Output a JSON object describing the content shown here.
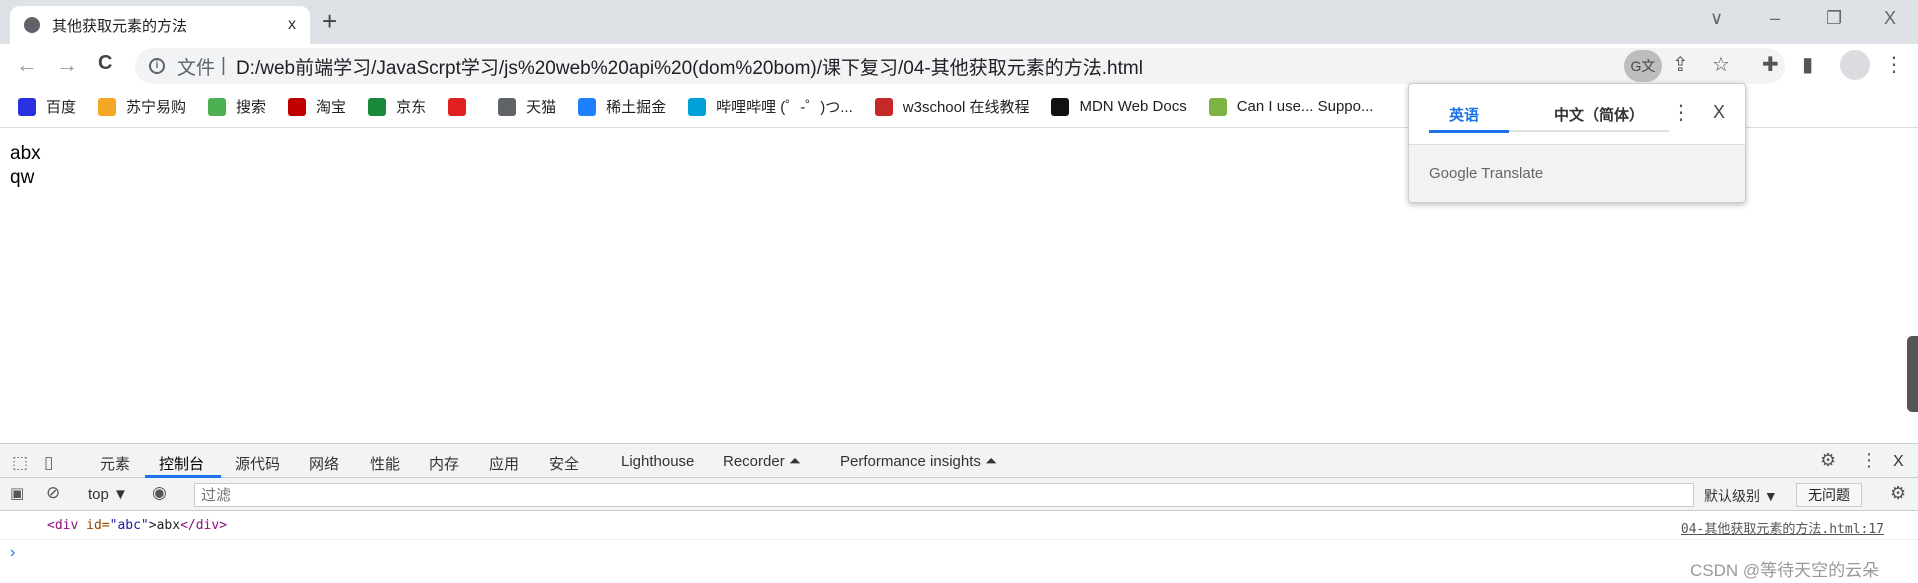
{
  "browser": {
    "tab_title": "其他获取元素的方法",
    "tab_close": "x",
    "new_tab": "+",
    "window_controls": {
      "tab_search": "∨",
      "minimize": "–",
      "restore": "❐",
      "close": "X"
    }
  },
  "toolbar": {
    "back": "←",
    "forward": "→",
    "reload": "C",
    "scheme_label": "文件",
    "separator": "|",
    "url": "D:/web前端学习/JavaScrpt学习/js%20web%20api%20(dom%20bom)/课下复习/04-其他获取元素的方法.html"
  },
  "bookmarks": [
    {
      "label": "百度",
      "color": "#2932e1"
    },
    {
      "label": "苏宁易购",
      "color": "#f5a623"
    },
    {
      "label": "搜索",
      "color": "#4caf50"
    },
    {
      "label": "淘宝",
      "color": "#c00000"
    },
    {
      "label": "京东",
      "color": "#1a8a3a"
    },
    {
      "label": "",
      "color": "#e02020"
    },
    {
      "label": "天猫",
      "color": "#5f6368"
    },
    {
      "label": "稀土掘金",
      "color": "#1e80ff"
    },
    {
      "label": "哔哩哔哩 (゜-゜)つ...",
      "color": "#00a1d6"
    },
    {
      "label": "w3school 在线教程",
      "color": "#c62828"
    },
    {
      "label": "MDN Web Docs",
      "color": "#111111"
    },
    {
      "label": "Can I use... Suppo...",
      "color": "#7cb342"
    }
  ],
  "page": {
    "lines": [
      "abx",
      "qw"
    ]
  },
  "translate_popup": {
    "source_lang": "英语",
    "target_lang": "中文（简体）",
    "more": "⋮",
    "close": "X",
    "footer": "Google Translate"
  },
  "devtools": {
    "tabs": [
      "元素",
      "控制台",
      "源代码",
      "网络",
      "性能",
      "内存",
      "应用",
      "安全",
      "Lighthouse",
      "Recorder ⏶",
      "Performance insights ⏶"
    ],
    "active_tab": "控制台",
    "context": "top ▼",
    "filter_placeholder": "过滤",
    "level": "默认级别 ▼",
    "issues": "无问题",
    "log": {
      "open_tag": "<div",
      "attr": " id=",
      "attr_val": "\"abc\"",
      "text": ">abx",
      "close_tag": "</div>",
      "source": "04-其他获取元素的方法.html:17"
    },
    "prompt": "›"
  },
  "watermark": "CSDN @等待天空的云朵"
}
